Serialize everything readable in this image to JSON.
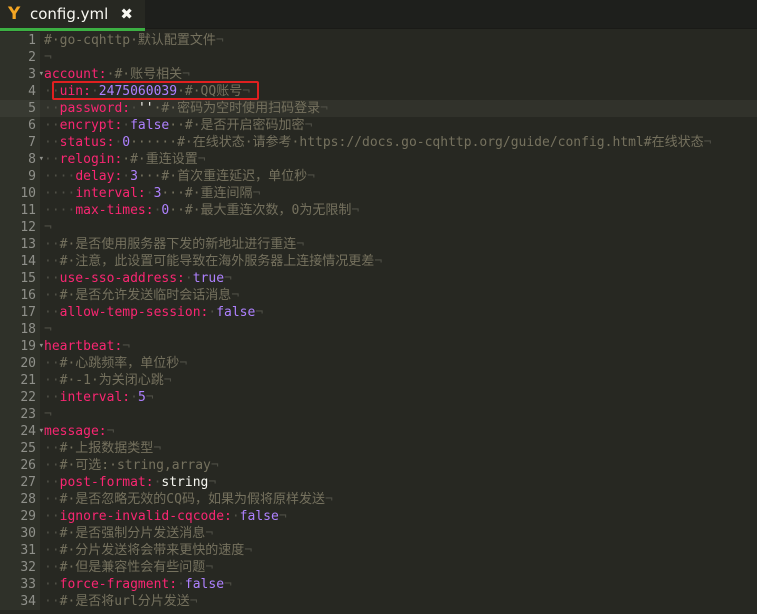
{
  "tab": {
    "title": "config.yml",
    "logo_icon": "yaml-logo-icon",
    "close_icon": "close-icon"
  },
  "colors": {
    "key": "#f92672",
    "number": "#ae81ff",
    "string": "#f8f8f2",
    "comment": "#75715e",
    "tab_accent": "#3cb043",
    "highlight_box": "#e02020"
  },
  "current_line": 5,
  "highlighted_line": 4,
  "fold_lines": [
    3,
    8,
    19,
    24
  ],
  "lines": [
    [
      [
        "c",
        "#·go-cqhttp·默认配置文件"
      ],
      [
        "w",
        "¬"
      ]
    ],
    [
      [
        "w",
        "¬"
      ]
    ],
    [
      [
        "k",
        "account:"
      ],
      [
        "c",
        "·#·账号相关"
      ],
      [
        "w",
        "¬"
      ]
    ],
    [
      [
        "w",
        "··"
      ],
      [
        "k",
        "uin:"
      ],
      [
        "w",
        "·"
      ],
      [
        "n",
        "2475060039"
      ],
      [
        "c",
        "·#·QQ账号"
      ],
      [
        "w",
        "¬"
      ]
    ],
    [
      [
        "w",
        "··"
      ],
      [
        "k",
        "password:"
      ],
      [
        "w",
        "·"
      ],
      [
        "s",
        "''"
      ],
      [
        "c",
        "·#·密码为空时使用扫码登录"
      ],
      [
        "w",
        "¬"
      ]
    ],
    [
      [
        "w",
        "··"
      ],
      [
        "k",
        "encrypt:"
      ],
      [
        "w",
        "·"
      ],
      [
        "n",
        "false"
      ],
      [
        "c",
        "··#·是否开启密码加密"
      ],
      [
        "w",
        "¬"
      ]
    ],
    [
      [
        "w",
        "··"
      ],
      [
        "k",
        "status:"
      ],
      [
        "w",
        "·"
      ],
      [
        "n",
        "0"
      ],
      [
        "c",
        "······#·在线状态·请参考·https://docs.go-cqhttp.org/guide/config.html#在线状态"
      ],
      [
        "w",
        "¬"
      ]
    ],
    [
      [
        "w",
        "··"
      ],
      [
        "k",
        "relogin:"
      ],
      [
        "c",
        "·#·重连设置"
      ],
      [
        "w",
        "¬"
      ]
    ],
    [
      [
        "w",
        "····"
      ],
      [
        "k",
        "delay:"
      ],
      [
        "w",
        "·"
      ],
      [
        "n",
        "3"
      ],
      [
        "c",
        "···#·首次重连延迟，单位秒"
      ],
      [
        "w",
        "¬"
      ]
    ],
    [
      [
        "w",
        "····"
      ],
      [
        "k",
        "interval:"
      ],
      [
        "w",
        "·"
      ],
      [
        "n",
        "3"
      ],
      [
        "c",
        "···#·重连间隔"
      ],
      [
        "w",
        "¬"
      ]
    ],
    [
      [
        "w",
        "····"
      ],
      [
        "k",
        "max-times:"
      ],
      [
        "w",
        "·"
      ],
      [
        "n",
        "0"
      ],
      [
        "c",
        "··#·最大重连次数，0为无限制"
      ],
      [
        "w",
        "¬"
      ]
    ],
    [
      [
        "w",
        "¬"
      ]
    ],
    [
      [
        "w",
        "··"
      ],
      [
        "c",
        "#·是否使用服务器下发的新地址进行重连"
      ],
      [
        "w",
        "¬"
      ]
    ],
    [
      [
        "w",
        "··"
      ],
      [
        "c",
        "#·注意，此设置可能导致在海外服务器上连接情况更差"
      ],
      [
        "w",
        "¬"
      ]
    ],
    [
      [
        "w",
        "··"
      ],
      [
        "k",
        "use-sso-address:"
      ],
      [
        "w",
        "·"
      ],
      [
        "n",
        "true"
      ],
      [
        "w",
        "¬"
      ]
    ],
    [
      [
        "w",
        "··"
      ],
      [
        "c",
        "#·是否允许发送临时会话消息"
      ],
      [
        "w",
        "¬"
      ]
    ],
    [
      [
        "w",
        "··"
      ],
      [
        "k",
        "allow-temp-session:"
      ],
      [
        "w",
        "·"
      ],
      [
        "n",
        "false"
      ],
      [
        "w",
        "¬"
      ]
    ],
    [
      [
        "w",
        "¬"
      ]
    ],
    [
      [
        "k",
        "heartbeat:"
      ],
      [
        "w",
        "¬"
      ]
    ],
    [
      [
        "w",
        "··"
      ],
      [
        "c",
        "#·心跳频率，单位秒"
      ],
      [
        "w",
        "¬"
      ]
    ],
    [
      [
        "w",
        "··"
      ],
      [
        "c",
        "#·-1·为关闭心跳"
      ],
      [
        "w",
        "¬"
      ]
    ],
    [
      [
        "w",
        "··"
      ],
      [
        "k",
        "interval:"
      ],
      [
        "w",
        "·"
      ],
      [
        "n",
        "5"
      ],
      [
        "w",
        "¬"
      ]
    ],
    [
      [
        "w",
        "¬"
      ]
    ],
    [
      [
        "k",
        "message:"
      ],
      [
        "w",
        "¬"
      ]
    ],
    [
      [
        "w",
        "··"
      ],
      [
        "c",
        "#·上报数据类型"
      ],
      [
        "w",
        "¬"
      ]
    ],
    [
      [
        "w",
        "··"
      ],
      [
        "c",
        "#·可选:·string,array"
      ],
      [
        "w",
        "¬"
      ]
    ],
    [
      [
        "w",
        "··"
      ],
      [
        "k",
        "post-format:"
      ],
      [
        "w",
        "·"
      ],
      [
        "s",
        "string"
      ],
      [
        "w",
        "¬"
      ]
    ],
    [
      [
        "w",
        "··"
      ],
      [
        "c",
        "#·是否忽略无效的CQ码，如果为假将原样发送"
      ],
      [
        "w",
        "¬"
      ]
    ],
    [
      [
        "w",
        "··"
      ],
      [
        "k",
        "ignore-invalid-cqcode:"
      ],
      [
        "w",
        "·"
      ],
      [
        "n",
        "false"
      ],
      [
        "w",
        "¬"
      ]
    ],
    [
      [
        "w",
        "··"
      ],
      [
        "c",
        "#·是否强制分片发送消息"
      ],
      [
        "w",
        "¬"
      ]
    ],
    [
      [
        "w",
        "··"
      ],
      [
        "c",
        "#·分片发送将会带来更快的速度"
      ],
      [
        "w",
        "¬"
      ]
    ],
    [
      [
        "w",
        "··"
      ],
      [
        "c",
        "#·但是兼容性会有些问题"
      ],
      [
        "w",
        "¬"
      ]
    ],
    [
      [
        "w",
        "··"
      ],
      [
        "k",
        "force-fragment:"
      ],
      [
        "w",
        "·"
      ],
      [
        "n",
        "false"
      ],
      [
        "w",
        "¬"
      ]
    ],
    [
      [
        "w",
        "··"
      ],
      [
        "c",
        "#·是否将url分片发送"
      ],
      [
        "w",
        "¬"
      ]
    ]
  ]
}
